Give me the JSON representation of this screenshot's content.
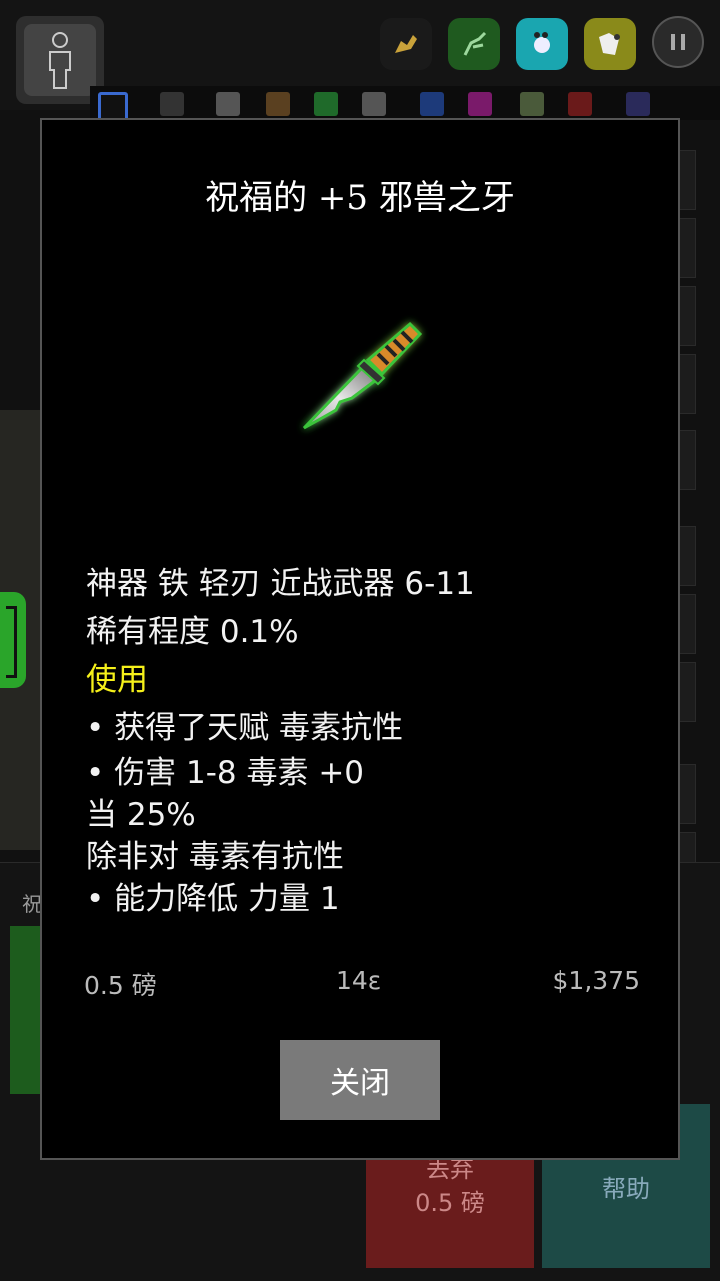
{
  "hud": {
    "pause_symbol": "II"
  },
  "item": {
    "title": "祝福的 +5 邪兽之牙",
    "icon": "knife-icon",
    "lines": {
      "type": "神器 铁 轻刃 近战武器 6-11",
      "rarity": "稀有程度 0.1%",
      "use_header": "使用",
      "effect1": "• 获得了天赋 毒素抗性",
      "effect2": "• 伤害 1-8 毒素 +0",
      "effect2_chance": "当 25%",
      "effect2_cond": "除非对 毒素有抗性",
      "effect3": "• 能力降低 力量 1"
    },
    "weight": "0.5 磅",
    "level": "14ε",
    "price": "$1,375",
    "close_label": "关闭"
  },
  "bottom": {
    "section_label": "祝",
    "drop_label": "丢弃",
    "drop_weight": "0.5 磅",
    "help_label": "帮助"
  },
  "colors": {
    "use_header": "#f5f01a",
    "close_button": "#7a7a7a",
    "drop_button": "#6a1c1c",
    "help_button": "#1d4a46"
  }
}
